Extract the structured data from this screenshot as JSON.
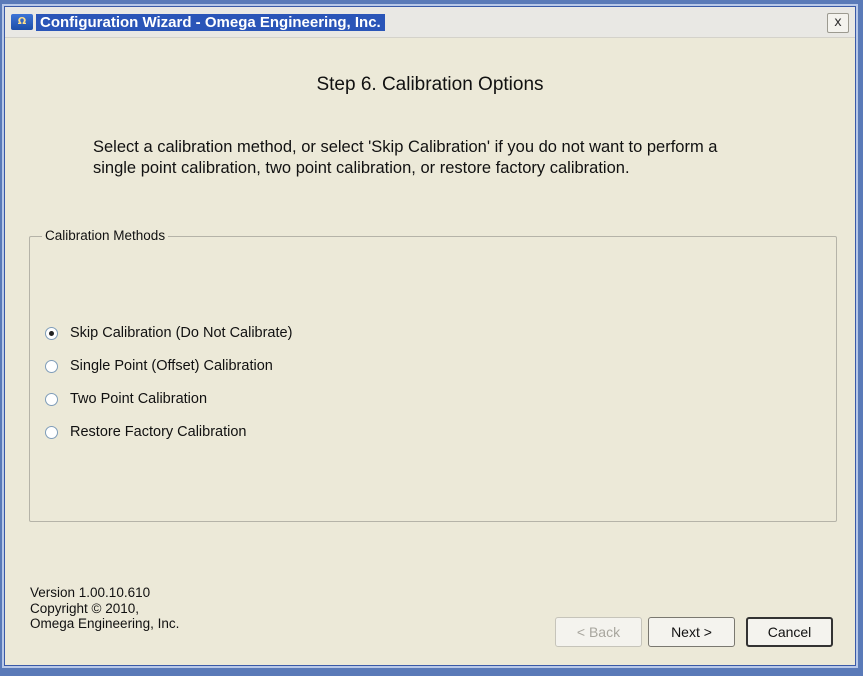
{
  "window": {
    "title": "Configuration Wizard - Omega Engineering, Inc.",
    "close_glyph": "x"
  },
  "step": {
    "title": "Step 6.  Calibration Options",
    "description": "Select a calibration method, or select 'Skip Calibration' if you do not want to perform a single point calibration, two point calibration, or restore factory calibration."
  },
  "calibration": {
    "group_label": "Calibration Methods",
    "options": [
      {
        "label": "Skip Calibration (Do Not Calibrate)",
        "checked": true
      },
      {
        "label": "Single Point (Offset) Calibration",
        "checked": false
      },
      {
        "label": "Two Point Calibration",
        "checked": false
      },
      {
        "label": "Restore Factory Calibration",
        "checked": false
      }
    ]
  },
  "footer": {
    "version": "Version 1.00.10.610",
    "copyright": "Copyright © 2010,",
    "company": "Omega Engineering, Inc."
  },
  "buttons": {
    "back": "< Back",
    "next": "Next >",
    "cancel": "Cancel"
  },
  "icons": {
    "app": "omega-app-icon",
    "close": "close-icon"
  }
}
